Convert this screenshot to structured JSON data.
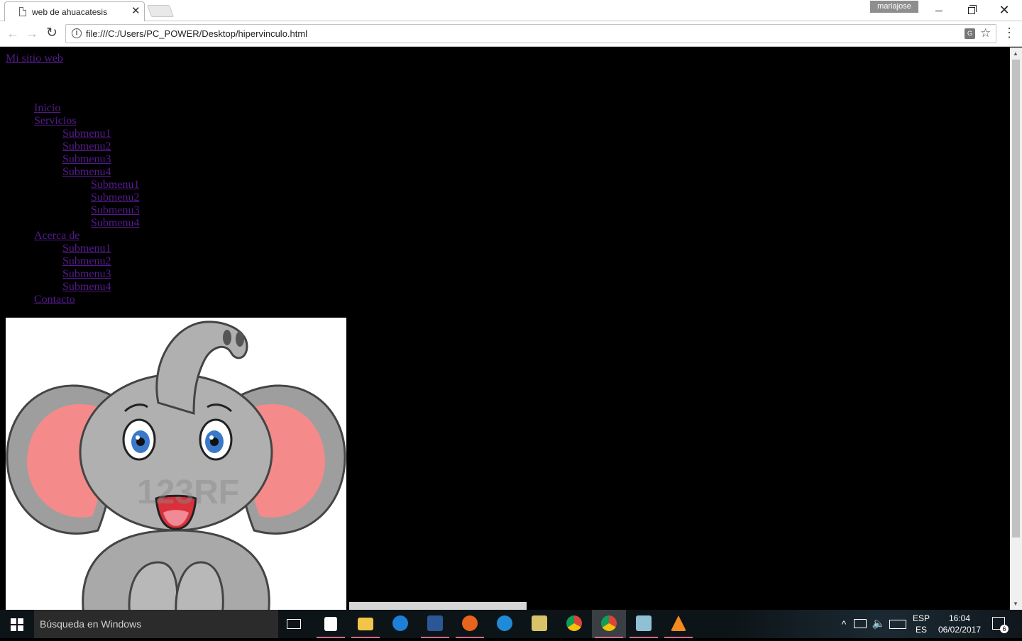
{
  "browser": {
    "tab_title": "web de ahuacatesis",
    "tab_close": "✕",
    "profile_name": "mariajose",
    "url": "file:///C:/Users/PC_POWER/Desktop/hipervinculo.html"
  },
  "page": {
    "site_title": "Mi sitio web",
    "menu": {
      "inicio": "Inicio",
      "servicios": "Servicios",
      "servicios_sub": [
        "Submenu1",
        "Submenu2",
        "Submenu3",
        "Submenu4"
      ],
      "servicios_sub4_sub": [
        "Submenu1",
        "Submenu2",
        "Submenu3",
        "Submenu4"
      ],
      "acerca": "Acerca de",
      "acerca_sub": [
        "Submenu1",
        "Submenu2",
        "Submenu3",
        "Submenu4"
      ],
      "contacto": "Contacto"
    },
    "image_watermark": "123RF"
  },
  "taskbar": {
    "search_placeholder": "Búsqueda en Windows",
    "lang_top": "ESP",
    "lang_bottom": "ES",
    "time": "16:04",
    "date": "06/02/2017",
    "notification_count": "6"
  },
  "colors": {
    "link": "#551a8b",
    "page_background": "#000000",
    "taskbar_active_indicator": "#d76a8c"
  }
}
